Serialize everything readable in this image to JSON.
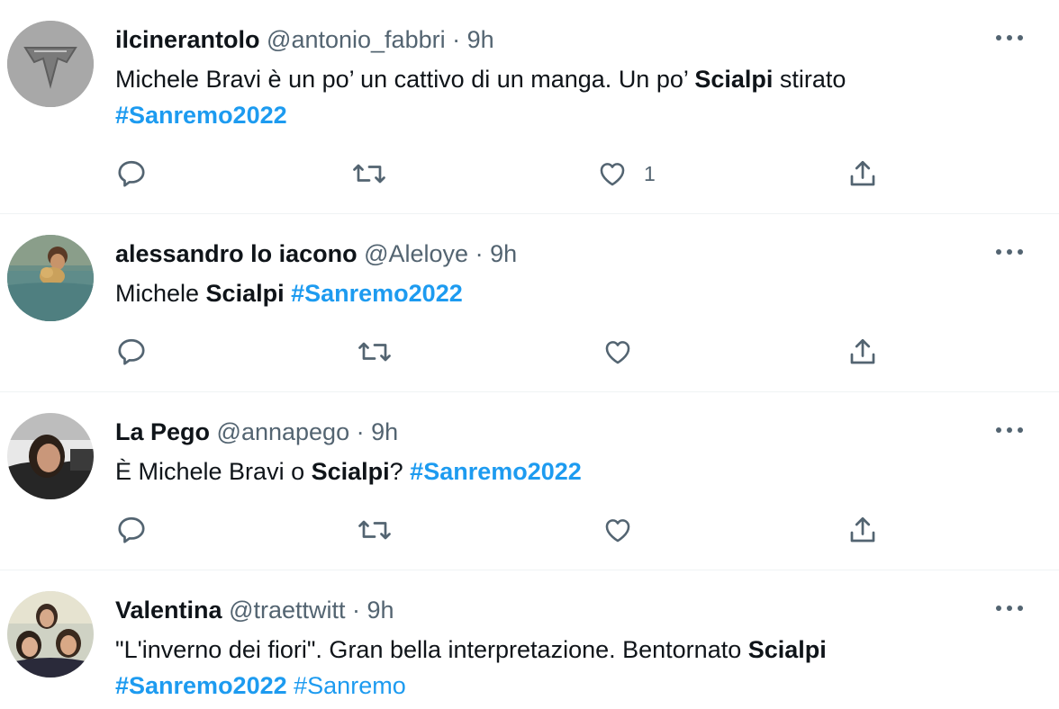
{
  "tweets": [
    {
      "name": "ilcinerantolo",
      "handle": "@antonio_fabbri",
      "dot": "·",
      "time": "9h",
      "text_parts": [
        "Michele Bravi è un po’ un cattivo di un manga. Un po’ ",
        "Scialpi",
        " stirato"
      ],
      "hashtags": [
        "#Sanremo2022"
      ],
      "like_count": "1",
      "avatar_icon": "fish-emblem-avatar"
    },
    {
      "name": "alessandro lo iacono",
      "handle": "@Aleloye",
      "dot": "·",
      "time": "9h",
      "text_parts": [
        "Michele ",
        "Scialpi",
        " "
      ],
      "hashtags": [
        "#Sanremo2022"
      ],
      "like_count": "",
      "avatar_icon": "person-with-dog-avatar"
    },
    {
      "name": "La Pego",
      "handle": "@annapego",
      "dot": "·",
      "time": "9h",
      "text_parts": [
        "È Michele Bravi o ",
        "Scialpi",
        "? "
      ],
      "hashtags": [
        "#Sanremo2022"
      ],
      "like_count": "",
      "avatar_icon": "woman-portrait-avatar"
    },
    {
      "name": "Valentina",
      "handle": "@traettwitt",
      "dot": "·",
      "time": "9h",
      "text_parts": [
        "\"L'inverno dei fiori\". Gran bella interpretazione. Bentornato ",
        "Scialpi"
      ],
      "hashtags": [
        "#Sanremo2022",
        "#Sanremo"
      ],
      "like_count": "",
      "avatar_icon": "group-photo-avatar"
    }
  ],
  "icons": {
    "reply": "reply-icon",
    "retweet": "retweet-icon",
    "like": "heart-icon",
    "share": "share-icon",
    "more": "more-icon"
  },
  "colors": {
    "hashtag": "#1d9bf0",
    "secondary_text": "#536471",
    "primary_text": "#0f1419",
    "divider": "#eff3f4"
  }
}
